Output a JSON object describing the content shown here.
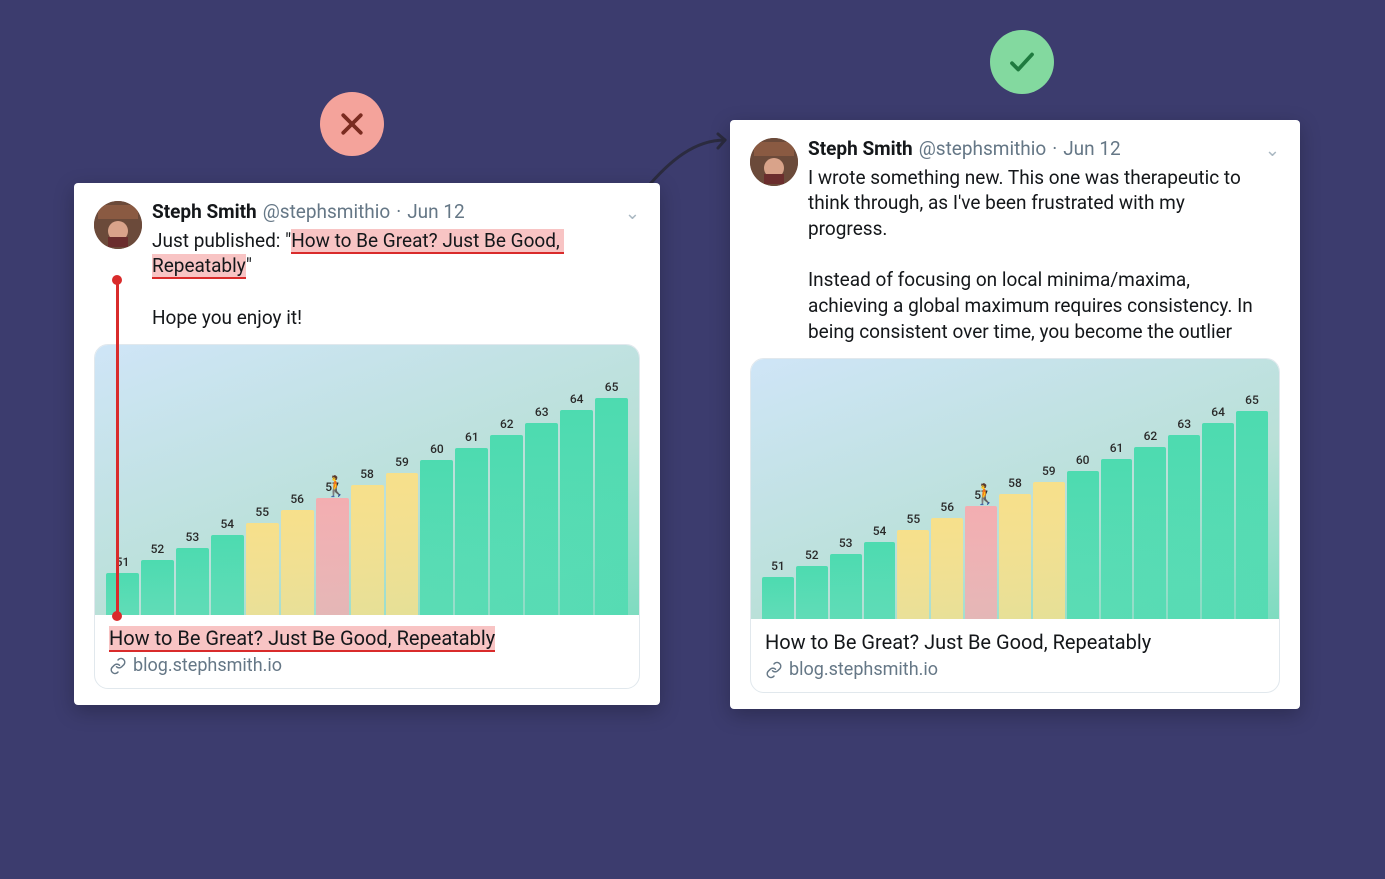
{
  "badges": {
    "bad_icon": "x-icon",
    "good_icon": "check-icon"
  },
  "left_tweet": {
    "author_name": "Steph Smith",
    "author_handle": "@stephsmithio",
    "date": "Jun 12",
    "sep": "·",
    "body_prefix": "Just published: \"",
    "body_highlight": "How to Be Great? Just Be Good, Repeatably",
    "body_suffix": "\"",
    "body_line2": "Hope you enjoy it!",
    "card_title": "How to Be Great? Just Be Good, Repeatably",
    "card_url": "blog.stephsmith.io"
  },
  "right_tweet": {
    "author_name": "Steph Smith",
    "author_handle": "@stephsmithio",
    "date": "Jun 12",
    "sep": "·",
    "body": "I wrote something new. This one was therapeutic to think through, as I've been frustrated with my progress.\n\nInstead of focusing on local minima/maxima, achieving a global maximum requires consistency. In being consistent over time, you become the outlier",
    "card_title": "How to Be Great? Just Be Good, Repeatably",
    "card_url": "blog.stephsmith.io"
  },
  "chart_data": {
    "type": "bar",
    "categories": [
      "51",
      "52",
      "53",
      "54",
      "55",
      "56",
      "57",
      "58",
      "59",
      "60",
      "61",
      "62",
      "63",
      "64",
      "65"
    ],
    "values": [
      51,
      52,
      53,
      54,
      55,
      56,
      57,
      58,
      59,
      60,
      61,
      62,
      63,
      64,
      65
    ],
    "title": "",
    "xlabel": "",
    "ylabel": "",
    "ylim": [
      0,
      100
    ],
    "colors": [
      "teal",
      "teal",
      "teal",
      "teal",
      "yellow",
      "yellow",
      "pink",
      "yellow",
      "yellow",
      "teal",
      "teal",
      "teal",
      "teal",
      "teal",
      "teal"
    ],
    "marker": {
      "index": 6,
      "icon": "walker"
    }
  }
}
